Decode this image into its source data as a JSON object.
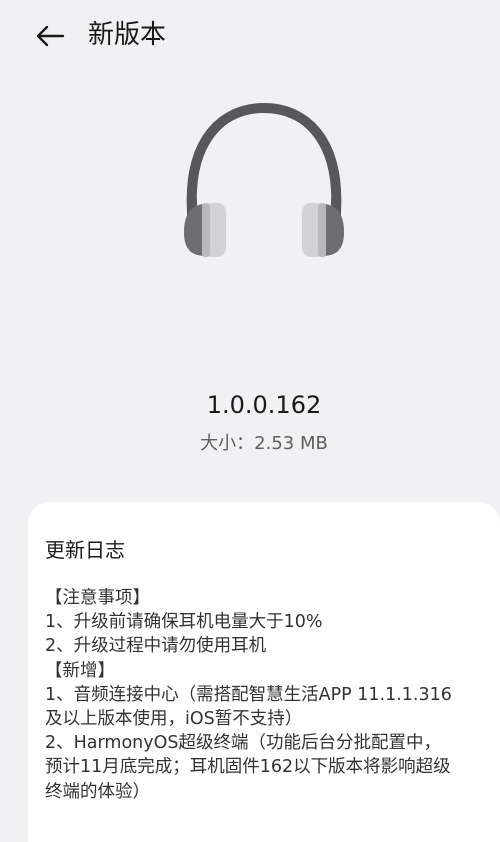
{
  "header": {
    "back_icon": "arrow-left-icon",
    "title": "新版本"
  },
  "device": {
    "icon": "headphones-icon",
    "colors": {
      "band": "#57575c",
      "cup": "#6d6d72",
      "cushion": "#cfcfd3"
    }
  },
  "update": {
    "version": "1.0.0.162",
    "size_line": "大小：2.53 MB"
  },
  "changelog": {
    "title": "更新日志",
    "lines": [
      "【注意事项】",
      "1、升级前请确保耳机电量大于10%",
      "2、升级过程中请勿使用耳机",
      "【新增】",
      "1、音频连接中心（需搭配智慧生活APP 11.1.1.316",
      "及以上版本使用，iOS暂不支持）",
      "2、HarmonyOS超级终端（功能后台分批配置中，",
      "预计11月底完成；耳机固件162以下版本将影响超级",
      "终端的体验）"
    ]
  }
}
